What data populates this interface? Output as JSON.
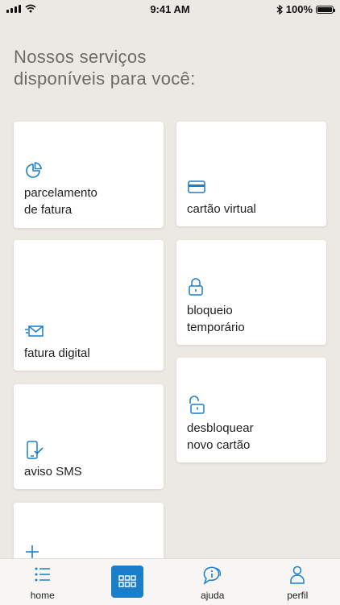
{
  "status_bar": {
    "time": "9:41 AM",
    "battery": "100%"
  },
  "title": "Nossos serviços\ndisponíveis para você:",
  "cards": {
    "parcelamento": "parcelamento\nde fatura",
    "cartao_virtual": "cartão virtual",
    "fatura_digital": "fatura digital",
    "bloqueio": "bloqueio\ntemporário",
    "aviso_sms": "aviso SMS",
    "desbloquear": "desbloquear\nnovo cartão"
  },
  "tabs": {
    "home": "home",
    "ajuda": "ajuda",
    "perfil": "perfil"
  },
  "colors": {
    "accent": "#1a7ecb",
    "background": "#ece8e4"
  }
}
